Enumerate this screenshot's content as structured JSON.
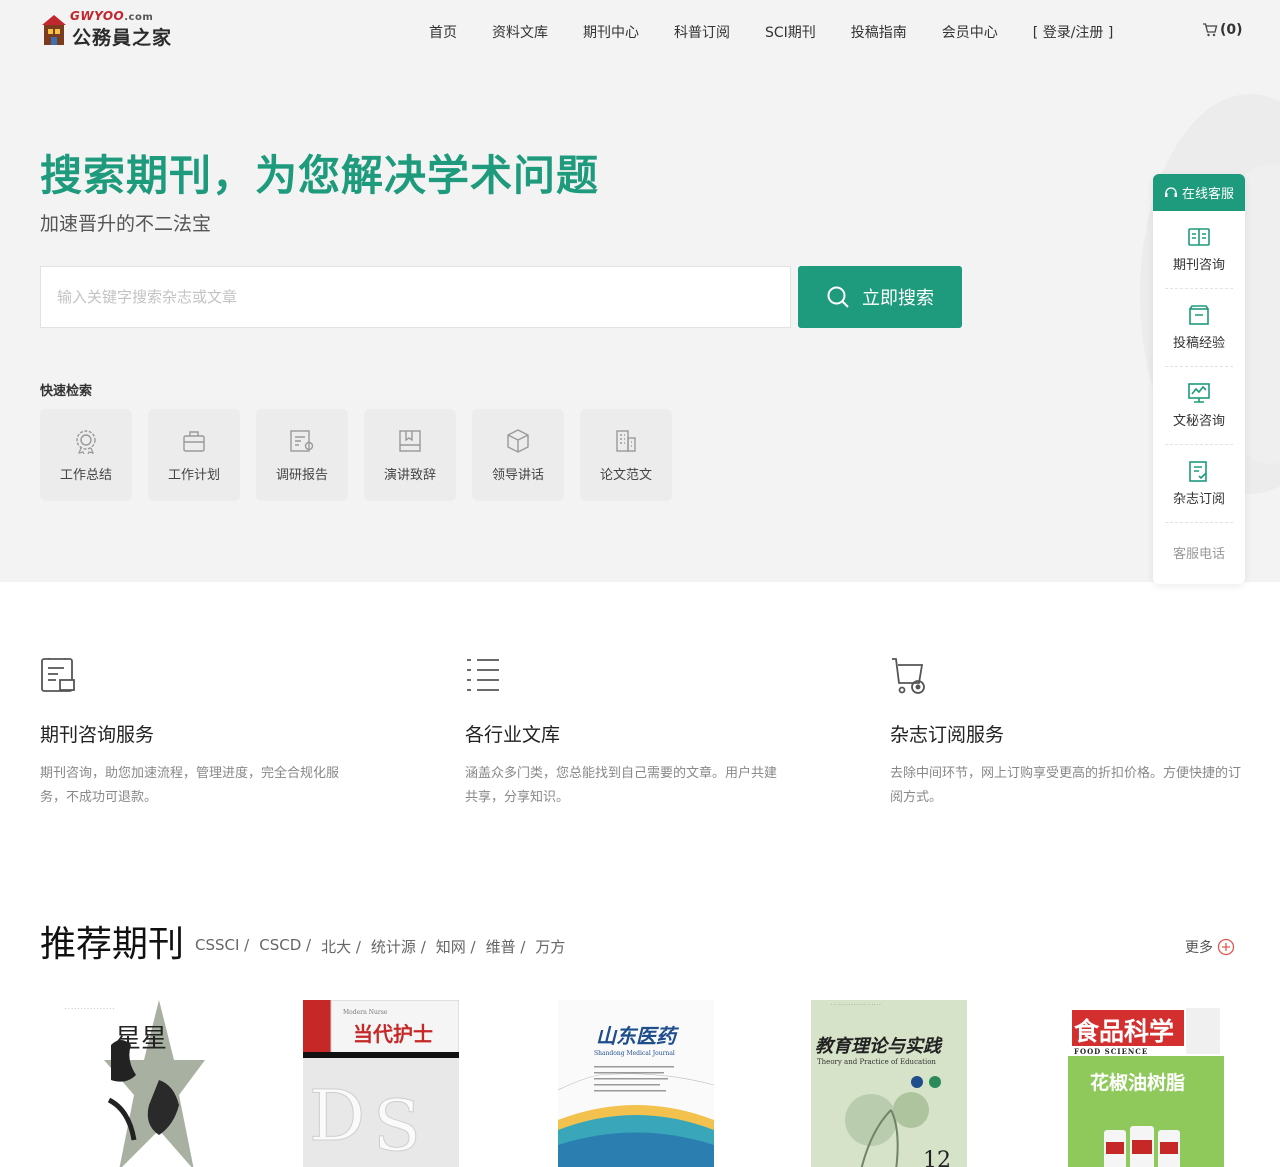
{
  "header": {
    "logo_domain": "GWYOO",
    "logo_domain_suffix": ".com",
    "logo_text": "公務員之家",
    "nav": [
      "首页",
      "资料文库",
      "期刊中心",
      "科普订阅",
      "SCI期刊",
      "投稿指南",
      "会员中心",
      "[ 登录/注册 ]"
    ],
    "cart_count": "(0)"
  },
  "hero": {
    "title": "搜索期刊，为您解决学术问题",
    "subtitle": "加速晋升的不二法宝",
    "search_placeholder": "输入关键字搜索杂志或文章",
    "search_button": "立即搜索",
    "quick_title": "快速检索",
    "quick_items": [
      {
        "label": "工作总结",
        "icon": "badge-icon"
      },
      {
        "label": "工作计划",
        "icon": "briefcase-icon"
      },
      {
        "label": "调研报告",
        "icon": "report-icon"
      },
      {
        "label": "演讲致辞",
        "icon": "book-icon"
      },
      {
        "label": "领导讲话",
        "icon": "cube-icon"
      },
      {
        "label": "论文范文",
        "icon": "building-icon"
      }
    ]
  },
  "side": {
    "head": "在线客服",
    "items": [
      {
        "label": "期刊咨询",
        "icon": "open-book-icon"
      },
      {
        "label": "投稿经验",
        "icon": "archive-icon"
      },
      {
        "label": "文秘咨询",
        "icon": "chart-icon"
      },
      {
        "label": "杂志订阅",
        "icon": "document-check-icon"
      }
    ],
    "phone": "客服电话"
  },
  "services": [
    {
      "title": "期刊咨询服务",
      "desc": "期刊咨询，助您加速流程，管理进度，完全合规化服务，不成功可退款。",
      "icon": "consult-icon"
    },
    {
      "title": "各行业文库",
      "desc": "涵盖众多门类，您总能找到自己需要的文章。用户共建共享，分享知识。",
      "icon": "list-icon"
    },
    {
      "title": "杂志订阅服务",
      "desc": "去除中间环节，网上订购享受更高的折扣价格。方便快捷的订阅方式。",
      "icon": "cart-icon"
    }
  ],
  "recommend": {
    "title": "推荐期刊",
    "tags": [
      "CSSCI /",
      "CSCD /",
      "北大 /",
      "统计源 /",
      "知网 /",
      "维普 /",
      "万方"
    ],
    "more": "更多",
    "covers": [
      {
        "title": "星星"
      },
      {
        "title": "当代护士",
        "subtitle": "Modern Nurse"
      },
      {
        "title": "山东医药",
        "subtitle": "Shandong Medical Journal"
      },
      {
        "title": "教育理论与实践",
        "subtitle": "Theory and Practice of Education",
        "issue": "12"
      },
      {
        "title": "食品科学",
        "subtitle": "FOOD SCIENCE",
        "headline": "花椒油树脂"
      }
    ]
  },
  "colors": {
    "accent": "#1e9a7c",
    "hero_bg": "#f3f3f3"
  }
}
